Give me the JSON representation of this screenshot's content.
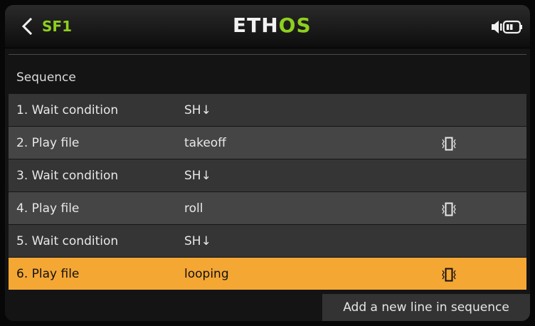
{
  "header": {
    "title": "SF1",
    "logo_part1": "ETH",
    "logo_part2": "OS"
  },
  "section": {
    "label": "Sequence"
  },
  "rows": [
    {
      "name": "1. Wait condition",
      "value": "SH↓",
      "vibrate": false
    },
    {
      "name": "2. Play file",
      "value": "takeoff",
      "vibrate": true
    },
    {
      "name": "3. Wait condition",
      "value": "SH↓",
      "vibrate": false
    },
    {
      "name": "4. Play file",
      "value": "roll",
      "vibrate": true
    },
    {
      "name": "5. Wait condition",
      "value": "SH↓",
      "vibrate": false
    },
    {
      "name": "6. Play file",
      "value": "looping",
      "vibrate": true,
      "selected": true
    }
  ],
  "footer": {
    "add_label": "Add a new line in sequence"
  },
  "colors": {
    "accent_green": "#8ecf1f",
    "selected_row": "#f5a734"
  },
  "icons": {
    "back": "chevron-left-icon",
    "speaker": "speaker-icon",
    "battery": "battery-icon",
    "vibrate": "vibrate-icon"
  }
}
